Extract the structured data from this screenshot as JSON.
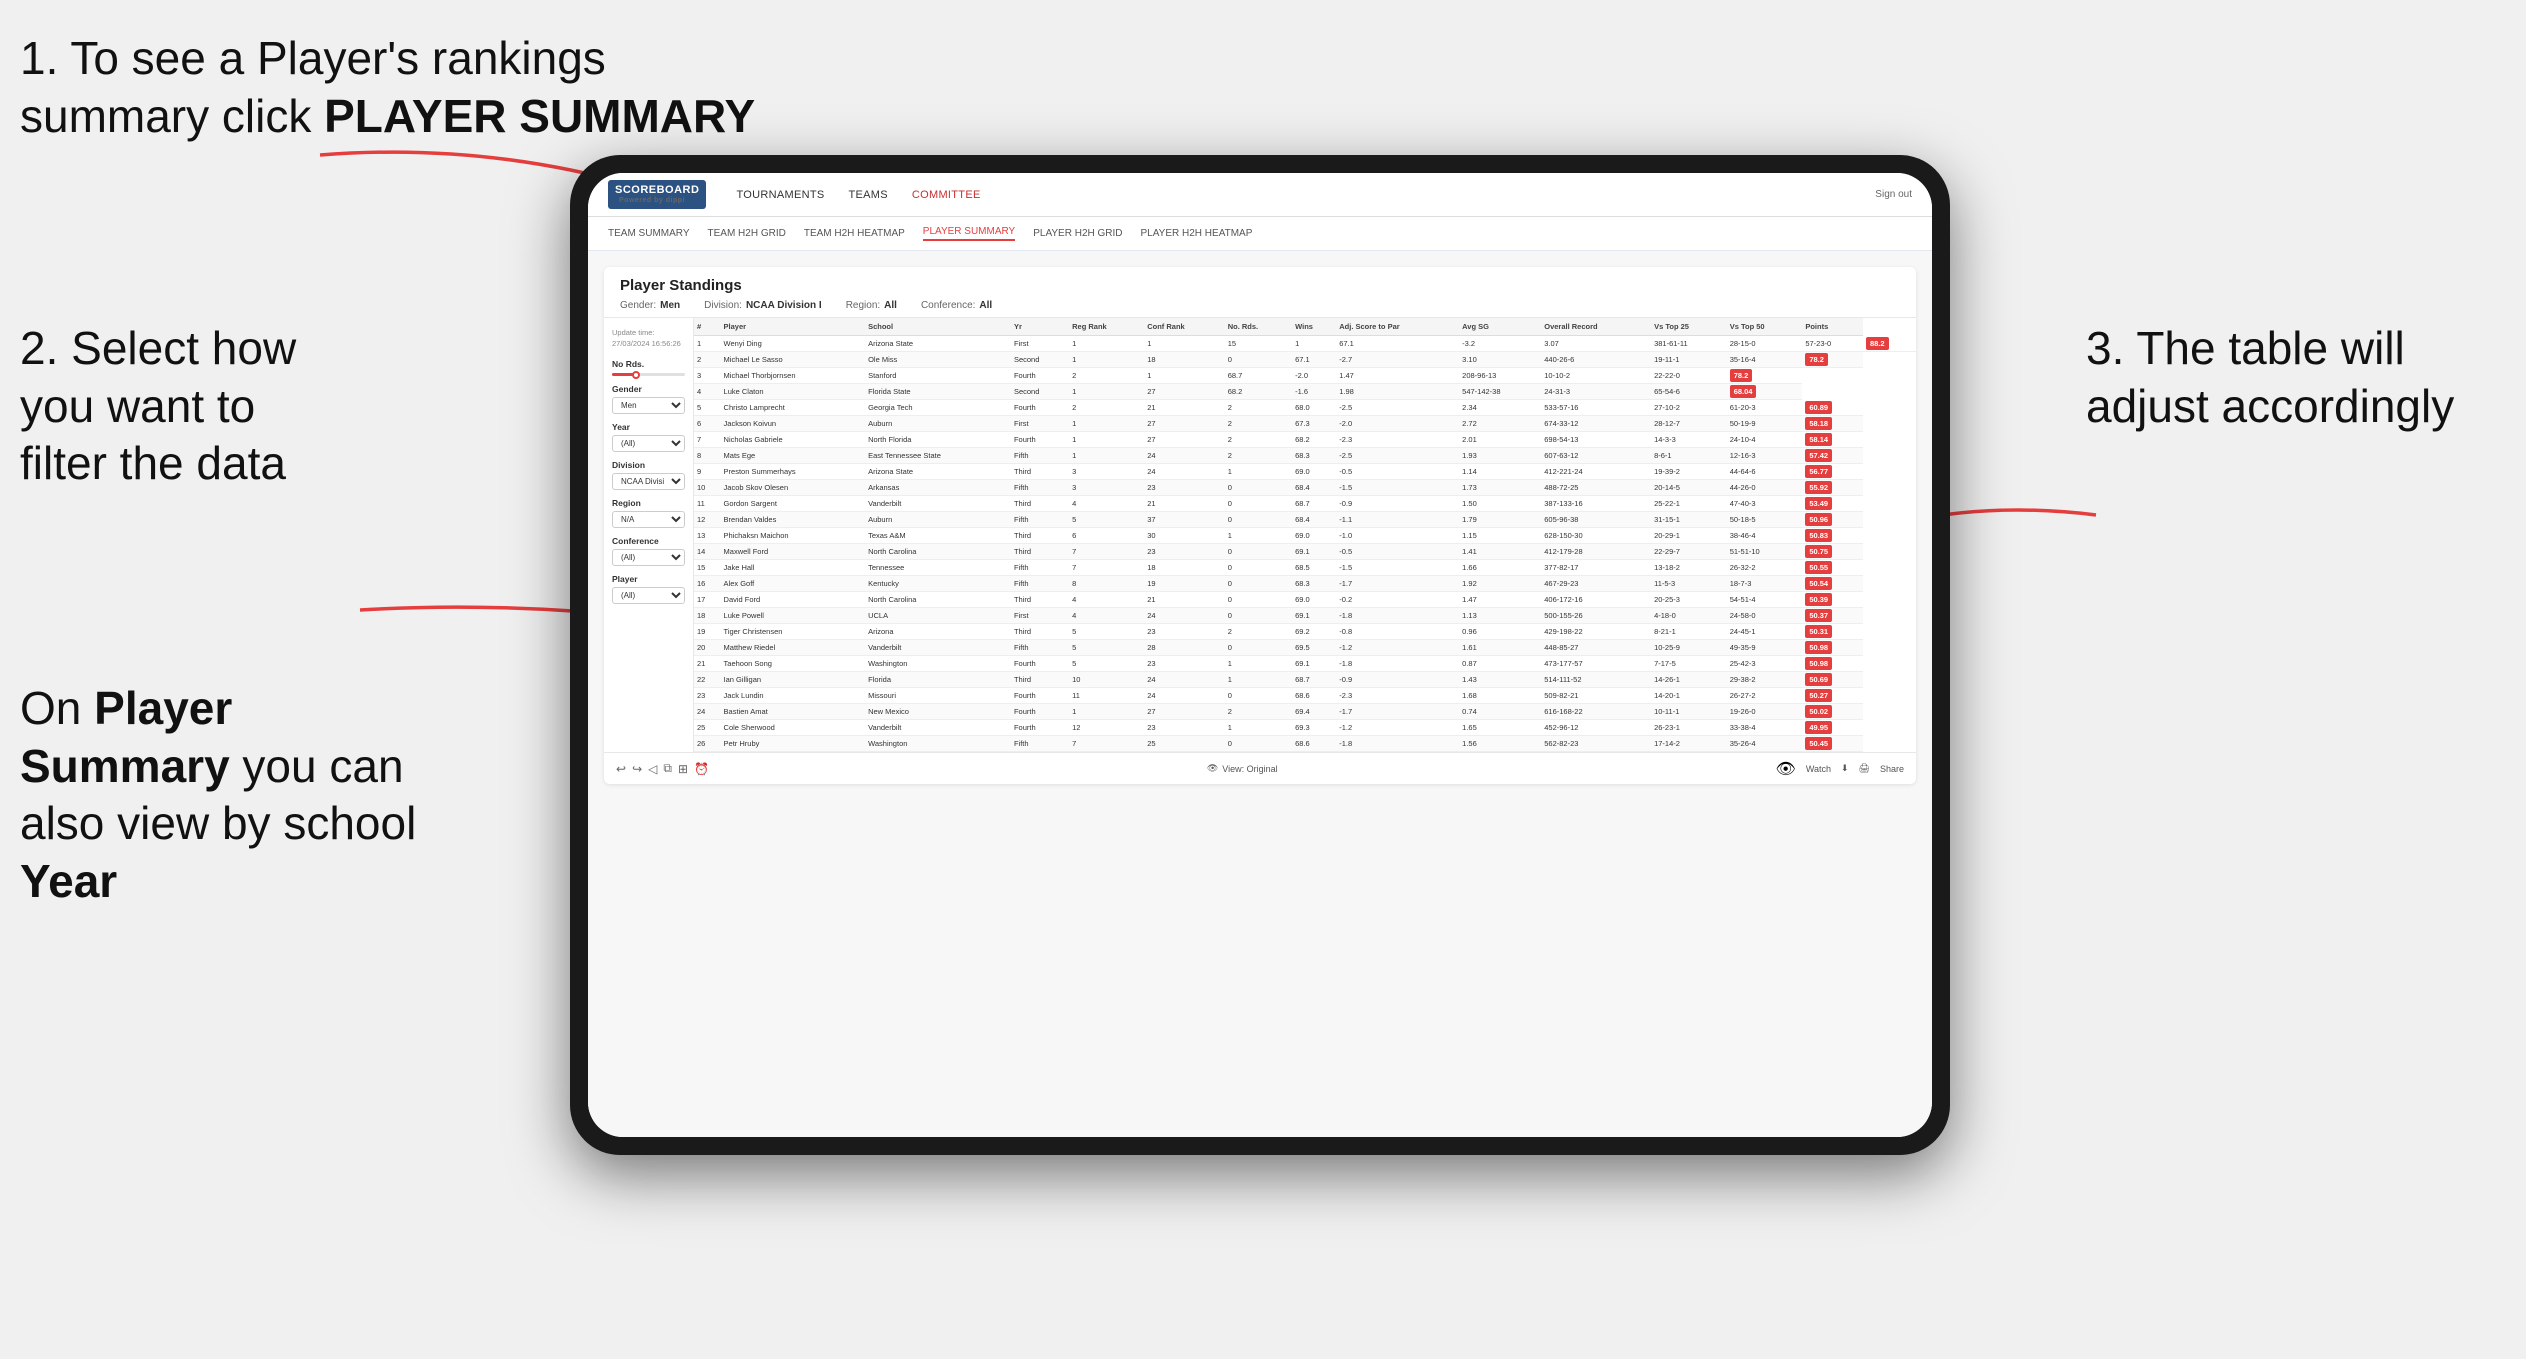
{
  "annotations": {
    "step1": "1. To see a Player's rankings summary click ",
    "step1_bold": "PLAYER SUMMARY",
    "step2_line1": "2. Select how",
    "step2_line2": "you want to",
    "step2_line3": "filter the data",
    "step3": "3. The table will adjust accordingly",
    "bottom_note_prefix": "On ",
    "bottom_note_bold1": "Player",
    "bottom_note_mid": " ",
    "bottom_note_bold2": "Summary",
    "bottom_note_end": " you can also view by school ",
    "bottom_note_bold3": "Year"
  },
  "nav": {
    "logo": "SCOREBOARD",
    "logo_sub": "Powered by dippi",
    "links": [
      "TOURNAMENTS",
      "TEAMS",
      "COMMITTEE"
    ],
    "sign_out": "Sign out"
  },
  "sub_nav": {
    "links": [
      "TEAM SUMMARY",
      "TEAM H2H GRID",
      "TEAM H2H HEATMAP",
      "PLAYER SUMMARY",
      "PLAYER H2H GRID",
      "PLAYER H2H HEATMAP"
    ]
  },
  "panel": {
    "title": "Player Standings",
    "filters": {
      "gender_label": "Gender:",
      "gender_value": "Men",
      "division_label": "Division:",
      "division_value": "NCAA Division I",
      "region_label": "Region:",
      "region_value": "All",
      "conference_label": "Conference:",
      "conference_value": "All"
    }
  },
  "sidebar": {
    "update_label": "Update time:",
    "update_time": "27/03/2024 16:56:26",
    "no_rds_label": "No Rds.",
    "gender_label": "Gender",
    "gender_value": "Men",
    "year_label": "Year",
    "year_value": "(All)",
    "division_label": "Division",
    "division_value": "NCAA Division I",
    "region_label": "Region",
    "region_value": "N/A",
    "conference_label": "Conference",
    "conference_value": "(All)",
    "player_label": "Player",
    "player_value": "(All)"
  },
  "table": {
    "headers": [
      "#",
      "Player",
      "School",
      "Yr",
      "Reg Rank",
      "Conf Rank",
      "No. Rds.",
      "Wins",
      "Adj. Score to Par",
      "Avg SG",
      "Overall Record",
      "Vs Top 25",
      "Vs Top 50",
      "Points"
    ],
    "rows": [
      [
        "1",
        "Wenyi Ding",
        "Arizona State",
        "First",
        "1",
        "1",
        "15",
        "1",
        "67.1",
        "-3.2",
        "3.07",
        "381-61-11",
        "28-15-0",
        "57-23-0",
        "88.2"
      ],
      [
        "2",
        "Michael Le Sasso",
        "Ole Miss",
        "Second",
        "1",
        "18",
        "0",
        "67.1",
        "-2.7",
        "3.10",
        "440-26-6",
        "19-11-1",
        "35-16-4",
        "78.2"
      ],
      [
        "3",
        "Michael Thorbjornsen",
        "Stanford",
        "Fourth",
        "2",
        "1",
        "68.7",
        "-2.0",
        "1.47",
        "208-96-13",
        "10-10-2",
        "22-22-0",
        "78.2"
      ],
      [
        "4",
        "Luke Claton",
        "Florida State",
        "Second",
        "1",
        "27",
        "68.2",
        "-1.6",
        "1.98",
        "547-142-38",
        "24-31-3",
        "65-54-6",
        "68.04"
      ],
      [
        "5",
        "Christo Lamprecht",
        "Georgia Tech",
        "Fourth",
        "2",
        "21",
        "2",
        "68.0",
        "-2.5",
        "2.34",
        "533-57-16",
        "27-10-2",
        "61-20-3",
        "60.89"
      ],
      [
        "6",
        "Jackson Koivun",
        "Auburn",
        "First",
        "1",
        "27",
        "2",
        "67.3",
        "-2.0",
        "2.72",
        "674-33-12",
        "28-12-7",
        "50-19-9",
        "58.18"
      ],
      [
        "7",
        "Nicholas Gabriele",
        "North Florida",
        "Fourth",
        "1",
        "27",
        "2",
        "68.2",
        "-2.3",
        "2.01",
        "698-54-13",
        "14-3-3",
        "24-10-4",
        "58.14"
      ],
      [
        "8",
        "Mats Ege",
        "East Tennessee State",
        "Fifth",
        "1",
        "24",
        "2",
        "68.3",
        "-2.5",
        "1.93",
        "607-63-12",
        "8-6-1",
        "12-16-3",
        "57.42"
      ],
      [
        "9",
        "Preston Summerhays",
        "Arizona State",
        "Third",
        "3",
        "24",
        "1",
        "69.0",
        "-0.5",
        "1.14",
        "412-221-24",
        "19-39-2",
        "44-64-6",
        "56.77"
      ],
      [
        "10",
        "Jacob Skov Olesen",
        "Arkansas",
        "Fifth",
        "3",
        "23",
        "0",
        "68.4",
        "-1.5",
        "1.73",
        "488-72-25",
        "20-14-5",
        "44-26-0",
        "55.92"
      ],
      [
        "11",
        "Gordon Sargent",
        "Vanderbilt",
        "Third",
        "4",
        "21",
        "0",
        "68.7",
        "-0.9",
        "1.50",
        "387-133-16",
        "25-22-1",
        "47-40-3",
        "53.49"
      ],
      [
        "12",
        "Brendan Valdes",
        "Auburn",
        "Fifth",
        "5",
        "37",
        "0",
        "68.4",
        "-1.1",
        "1.79",
        "605-96-38",
        "31-15-1",
        "50-18-5",
        "50.96"
      ],
      [
        "13",
        "Phichaksn Maichon",
        "Texas A&M",
        "Third",
        "6",
        "30",
        "1",
        "69.0",
        "-1.0",
        "1.15",
        "628-150-30",
        "20-29-1",
        "38-46-4",
        "50.83"
      ],
      [
        "14",
        "Maxwell Ford",
        "North Carolina",
        "Third",
        "7",
        "23",
        "0",
        "69.1",
        "-0.5",
        "1.41",
        "412-179-28",
        "22-29-7",
        "51-51-10",
        "50.75"
      ],
      [
        "15",
        "Jake Hall",
        "Tennessee",
        "Fifth",
        "7",
        "18",
        "0",
        "68.5",
        "-1.5",
        "1.66",
        "377-82-17",
        "13-18-2",
        "26-32-2",
        "50.55"
      ],
      [
        "16",
        "Alex Goff",
        "Kentucky",
        "Fifth",
        "8",
        "19",
        "0",
        "68.3",
        "-1.7",
        "1.92",
        "467-29-23",
        "11-5-3",
        "18-7-3",
        "50.54"
      ],
      [
        "17",
        "David Ford",
        "North Carolina",
        "Third",
        "4",
        "21",
        "0",
        "69.0",
        "-0.2",
        "1.47",
        "406-172-16",
        "20-25-3",
        "54-51-4",
        "50.39"
      ],
      [
        "18",
        "Luke Powell",
        "UCLA",
        "First",
        "4",
        "24",
        "0",
        "69.1",
        "-1.8",
        "1.13",
        "500-155-26",
        "4-18-0",
        "24-58-0",
        "50.37"
      ],
      [
        "19",
        "Tiger Christensen",
        "Arizona",
        "Third",
        "5",
        "23",
        "2",
        "69.2",
        "-0.8",
        "0.96",
        "429-198-22",
        "8-21-1",
        "24-45-1",
        "50.31"
      ],
      [
        "20",
        "Matthew Riedel",
        "Vanderbilt",
        "Fifth",
        "5",
        "28",
        "0",
        "69.5",
        "-1.2",
        "1.61",
        "448-85-27",
        "10-25-9",
        "49-35-9",
        "50.98"
      ],
      [
        "21",
        "Taehoon Song",
        "Washington",
        "Fourth",
        "5",
        "23",
        "1",
        "69.1",
        "-1.8",
        "0.87",
        "473-177-57",
        "7-17-5",
        "25-42-3",
        "50.98"
      ],
      [
        "22",
        "Ian Gilligan",
        "Florida",
        "Third",
        "10",
        "24",
        "1",
        "68.7",
        "-0.9",
        "1.43",
        "514-111-52",
        "14-26-1",
        "29-38-2",
        "50.69"
      ],
      [
        "23",
        "Jack Lundin",
        "Missouri",
        "Fourth",
        "11",
        "24",
        "0",
        "68.6",
        "-2.3",
        "1.68",
        "509-82-21",
        "14-20-1",
        "26-27-2",
        "50.27"
      ],
      [
        "24",
        "Bastien Amat",
        "New Mexico",
        "Fourth",
        "1",
        "27",
        "2",
        "69.4",
        "-1.7",
        "0.74",
        "616-168-22",
        "10-11-1",
        "19-26-0",
        "50.02"
      ],
      [
        "25",
        "Cole Sherwood",
        "Vanderbilt",
        "Fourth",
        "12",
        "23",
        "1",
        "69.3",
        "-1.2",
        "1.65",
        "452-96-12",
        "26-23-1",
        "33-38-4",
        "49.95"
      ],
      [
        "26",
        "Petr Hruby",
        "Washington",
        "Fifth",
        "7",
        "25",
        "0",
        "68.6",
        "-1.8",
        "1.56",
        "562-82-23",
        "17-14-2",
        "35-26-4",
        "50.45"
      ]
    ]
  },
  "toolbar": {
    "view_label": "View: Original",
    "watch_label": "Watch",
    "share_label": "Share"
  }
}
